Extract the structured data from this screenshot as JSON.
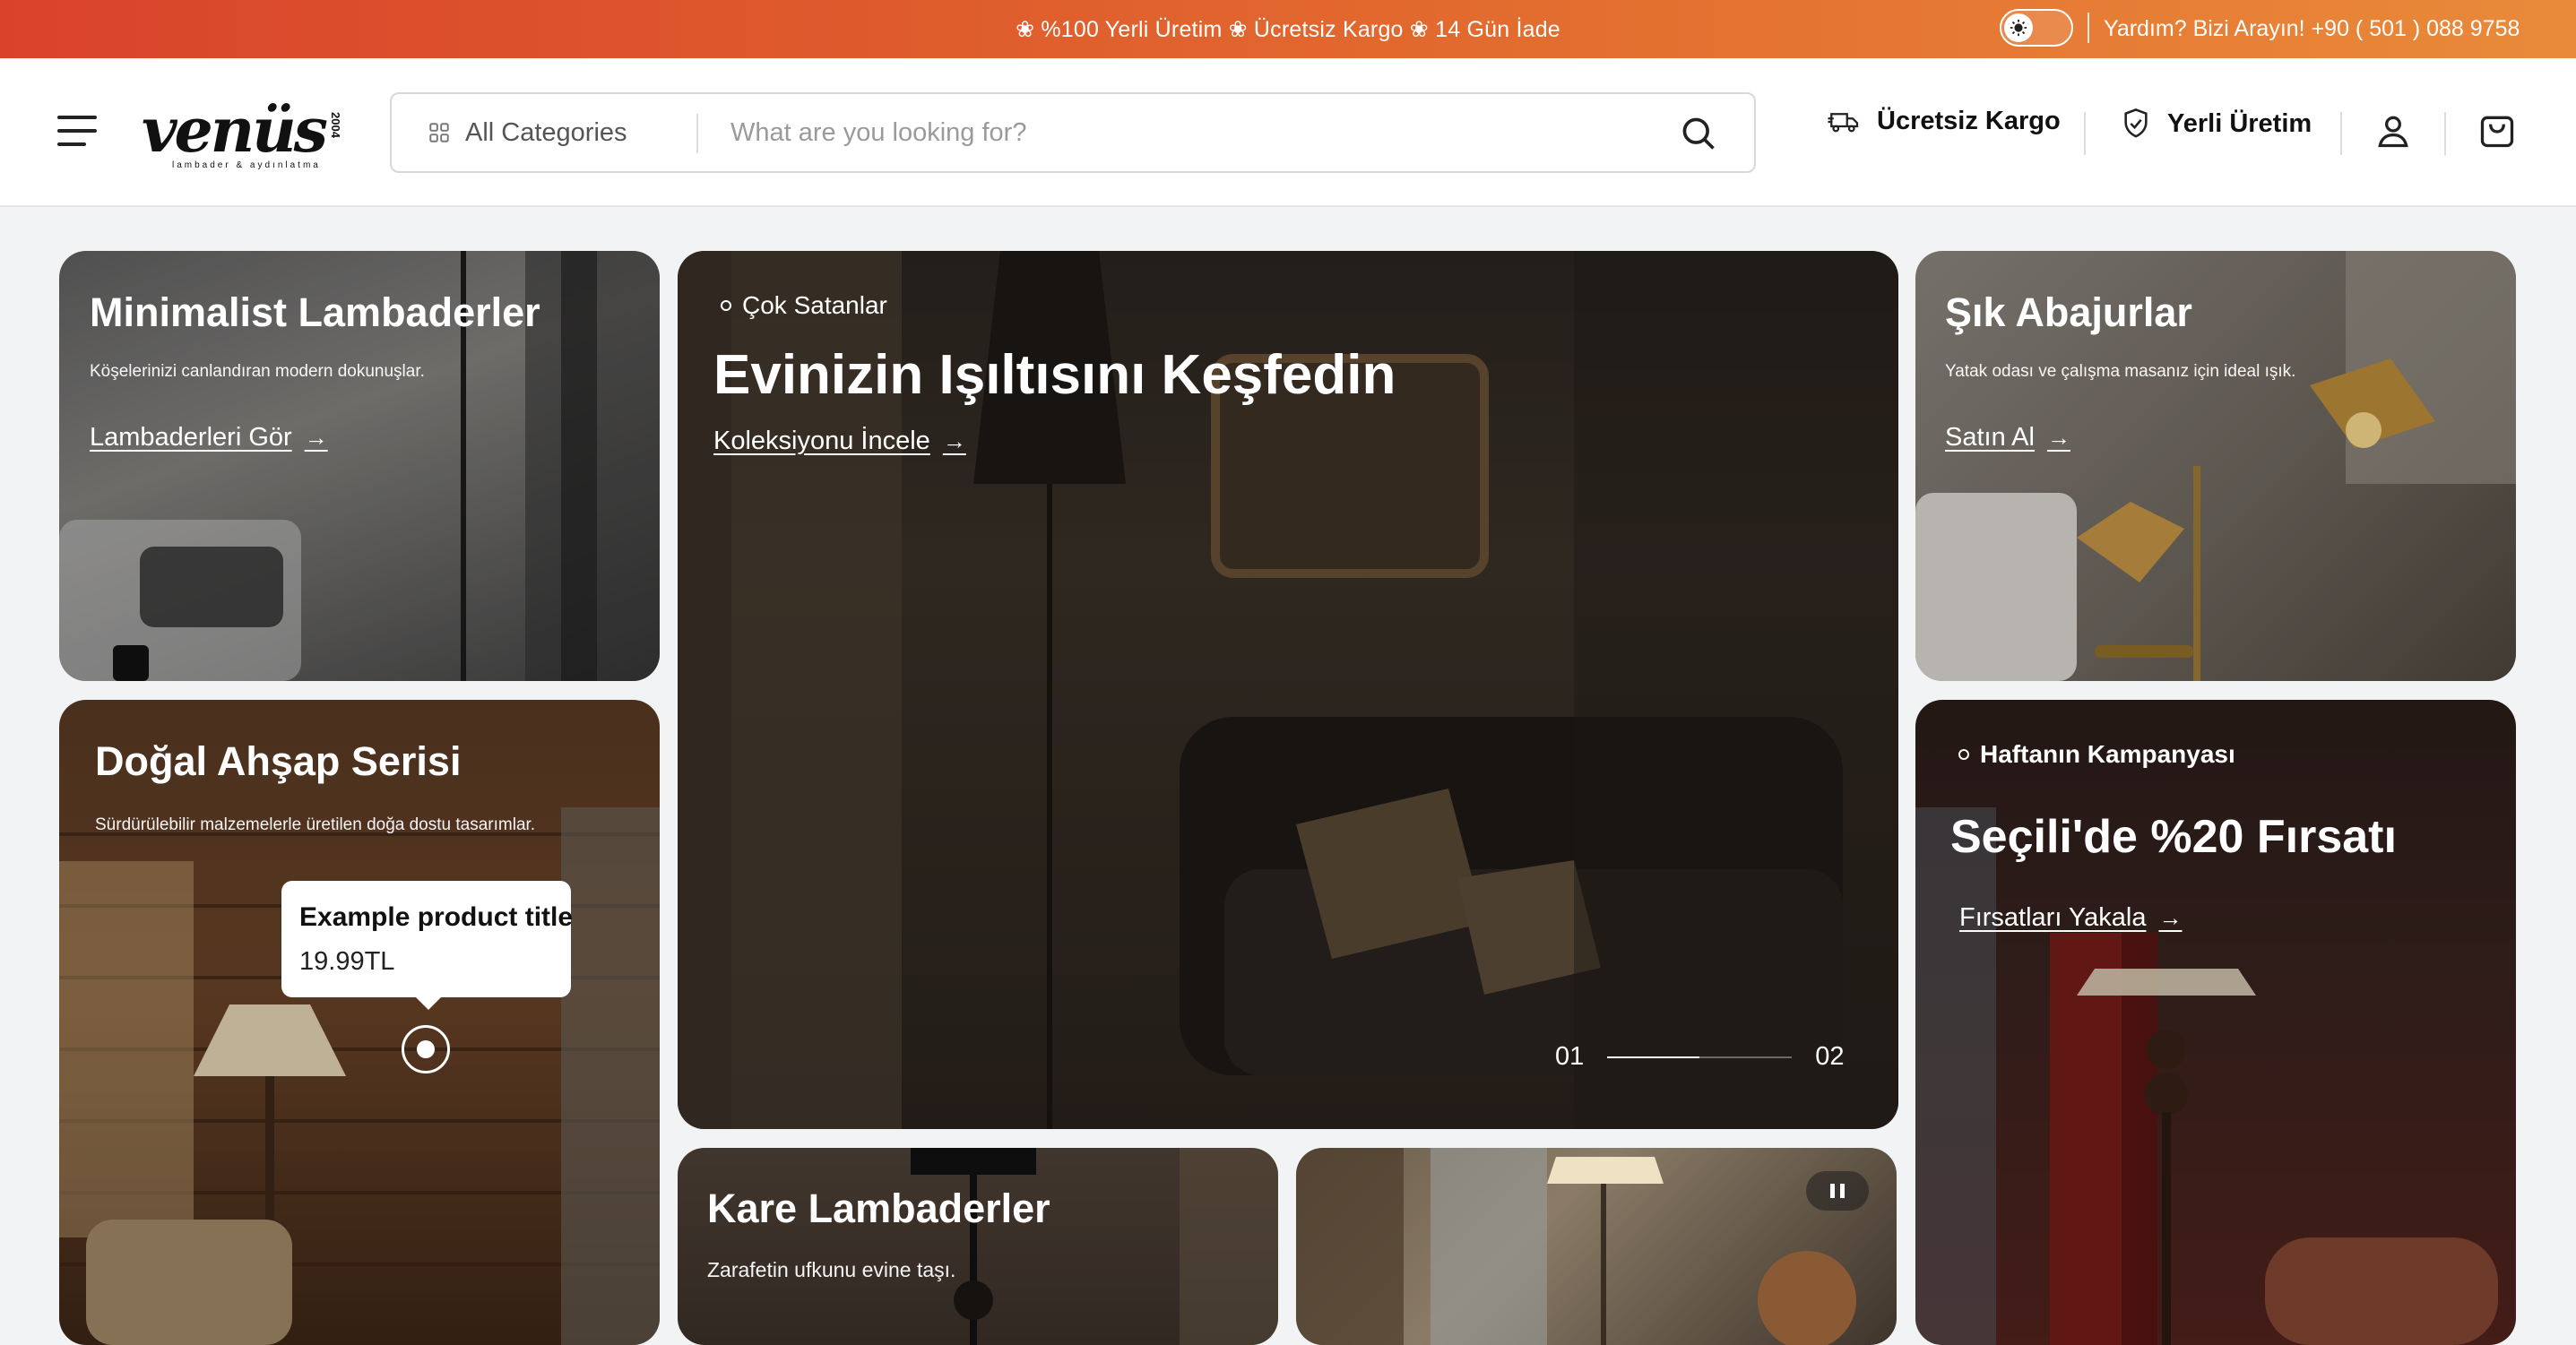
{
  "topbar": {
    "promo": "❀ %100 Yerli Üretim ❀ Ücretsiz Kargo ❀ 14 Gün İade",
    "help": "Yardım? Bizi Arayın! +90 ( 501 ) 088 9758",
    "theme_toggle_icon": "sun-icon"
  },
  "header": {
    "logo_text": "venüs",
    "logo_side": "2004",
    "logo_tagline": "lambader & aydınlatma",
    "search": {
      "category": "All Categories",
      "placeholder": "What are you looking for?"
    },
    "features": [
      {
        "label": "Ücretsiz Kargo",
        "icon": "truck-icon"
      },
      {
        "label": "Yerli Üretim",
        "icon": "shield-check-icon"
      }
    ]
  },
  "cards": {
    "minimalist": {
      "title": "Minimalist Lambaderler",
      "desc": "Köşelerinizi canlandıran modern dokunuşlar.",
      "link": "Lambaderleri Gör"
    },
    "hero": {
      "tag": "Çok Satanlar",
      "title": "Evinizin Işıltısını Keşfedin",
      "link": "Koleksiyonu İncele",
      "pager_current": "01",
      "pager_next": "02",
      "progress": 0.5
    },
    "abajur": {
      "title": "Şık Abajurlar",
      "desc": "Yatak odası ve çalışma masanız için ideal ışık.",
      "link": "Satın Al"
    },
    "ahsap": {
      "title": "Doğal Ahşap Serisi",
      "desc": "Sürdürülebilir malzemelerle üretilen doğa dostu tasarımlar.",
      "tooltip_title": "Example product title",
      "tooltip_price": "19.99TL"
    },
    "kampanya": {
      "tag": "Haftanın Kampanyası",
      "title": "Seçili'de %20 Fırsatı",
      "link": "Fırsatları Yakala"
    },
    "kare": {
      "title": "Kare Lambaderler",
      "desc": "Zarafetin ufkunu evine taşı."
    }
  },
  "colors": {
    "topbar_start": "#d9432b",
    "topbar_end": "#e98a3a",
    "page_bg": "#f2f3f5"
  }
}
